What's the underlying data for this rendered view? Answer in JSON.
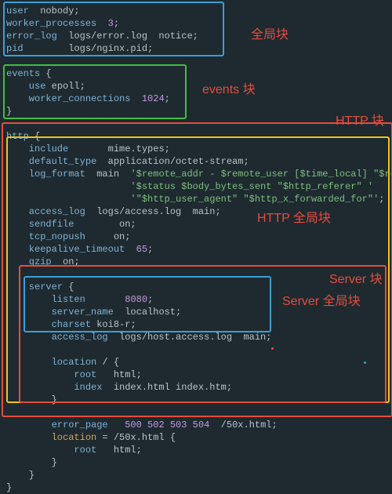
{
  "labels": {
    "global": "全局块",
    "events": "events 块",
    "http": "HTTP 块",
    "httpGlobal": "HTTP 全局块",
    "server": "Server 块",
    "serverGlobal": "Server 全局块"
  },
  "code": {
    "global": {
      "l1": {
        "a": "user",
        "b": "  nobody;"
      },
      "l2": {
        "a": "worker_processes",
        "b": "  ",
        "c": "3",
        "d": ";"
      },
      "l3": {
        "a": "error_log",
        "b": "  logs/error.log  notice;"
      },
      "l4": {
        "a": "pid",
        "b": "        logs/nginx.pid;"
      }
    },
    "events": {
      "open": {
        "a": "events",
        " b": " {"
      },
      "l1": {
        "a": "    use",
        " b": " epoll;"
      },
      "l2": {
        "a": "    worker_connections",
        "b": "  ",
        "c": "1024",
        "d": ";"
      },
      "close": "}"
    },
    "http": {
      "open": {
        "a": "http",
        "b": " {"
      },
      "l1": {
        "a": "    include",
        "b": "       mime.types;"
      },
      "l2": {
        "a": "    default_type",
        "b": "  application/octet-stream;"
      },
      "l3": {
        "a": "    log_format",
        "b": "  main  ",
        "c": "'$remote_addr - $remote_user [$time_local] \"$request\" '"
      },
      "l4": {
        "c": "                      '$status $body_bytes_sent \"$http_referer\" '"
      },
      "l5": {
        "c": "                      '\"$http_user_agent\" \"$http_x_forwarded_for\"'",
        "d": ";"
      },
      "l6": {
        "a": "    access_log",
        "b": "  logs/access.log  main;"
      },
      "l7": {
        "a": "    sendfile",
        "b": "        on;"
      },
      "l8": {
        "a": "    tcp_nopush",
        "b": "     on;"
      },
      "l9": {
        "a": "    keepalive_timeout",
        "b": "  ",
        "c": "65",
        "d": ";"
      },
      "l10": {
        "a": "    gzip",
        "b": "  on;"
      },
      "server": {
        "open": {
          "a": "    server",
          "b": " {"
        },
        "l1": {
          "a": "        listen",
          "b": "       ",
          "c": "8080",
          "d": ";"
        },
        "l2": {
          "a": "        server_name",
          "b": "  localhost;"
        },
        "l3": {
          "a": "        charset",
          "b": " koi8-r;"
        },
        "l4": {
          "a": "        access_log",
          "b": "  logs/host.access.log  main;"
        },
        "loc1": {
          "open": {
            "a": "        location",
            "b": " / {"
          },
          "l1": {
            "a": "            root",
            "b": "   html;"
          },
          "l2": {
            "a": "            index",
            "b": "  index.html index.htm;"
          },
          "close": "        }"
        },
        "l5": {
          "a": "        error_page",
          "b": "   ",
          "c": "500",
          "d": " ",
          "e": "502",
          "f": " ",
          "g": "503",
          "h": " ",
          "i": "504",
          "j": "  /50x.html;"
        },
        "loc2": {
          "open": {
            "a": "        location",
            "b": " = /50x.html {"
          },
          "l1": {
            "a": "            root",
            "b": "   html;"
          },
          "close": "        }"
        },
        "close": "    }"
      },
      "close": "}"
    }
  }
}
